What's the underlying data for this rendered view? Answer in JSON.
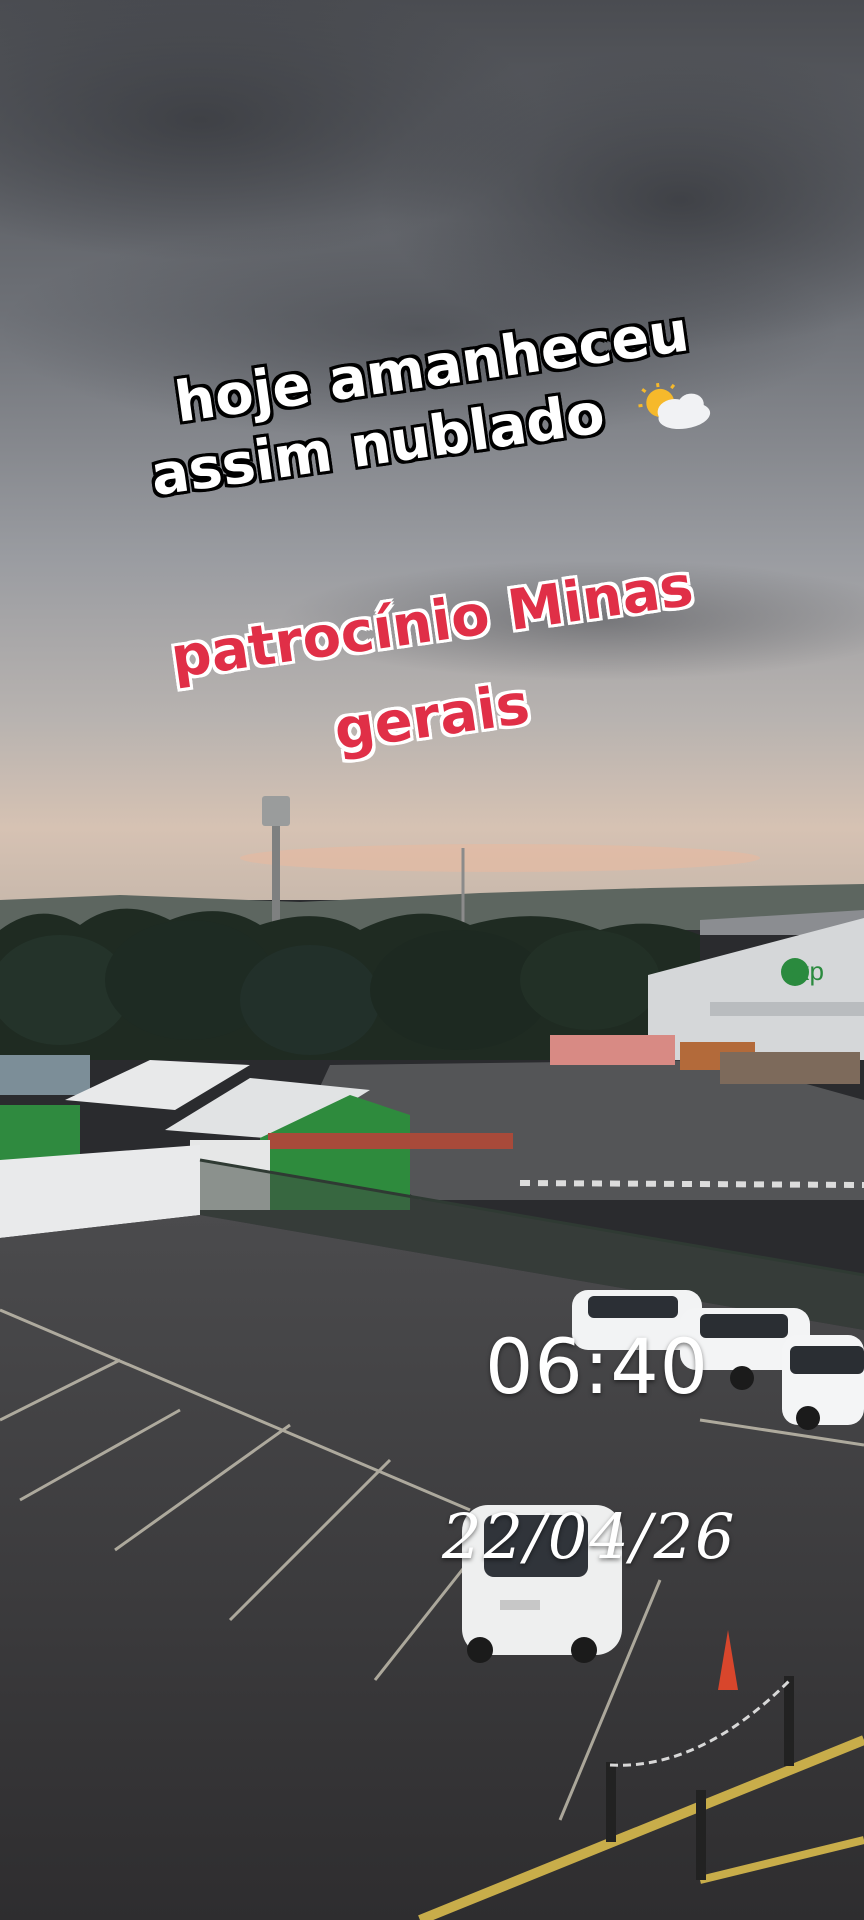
{
  "caption": {
    "line1": "hoje amanheceu",
    "line2": "assim nublado",
    "emoji": "sun-behind-cloud-icon",
    "line3": "patrocínio Minas",
    "line4": "gerais"
  },
  "timestamp": {
    "time": "06:40",
    "date": "22/04/26"
  },
  "building_sign": "exp",
  "colors": {
    "caption_red": "#e02f47",
    "sign_green": "#2a8a3e"
  }
}
